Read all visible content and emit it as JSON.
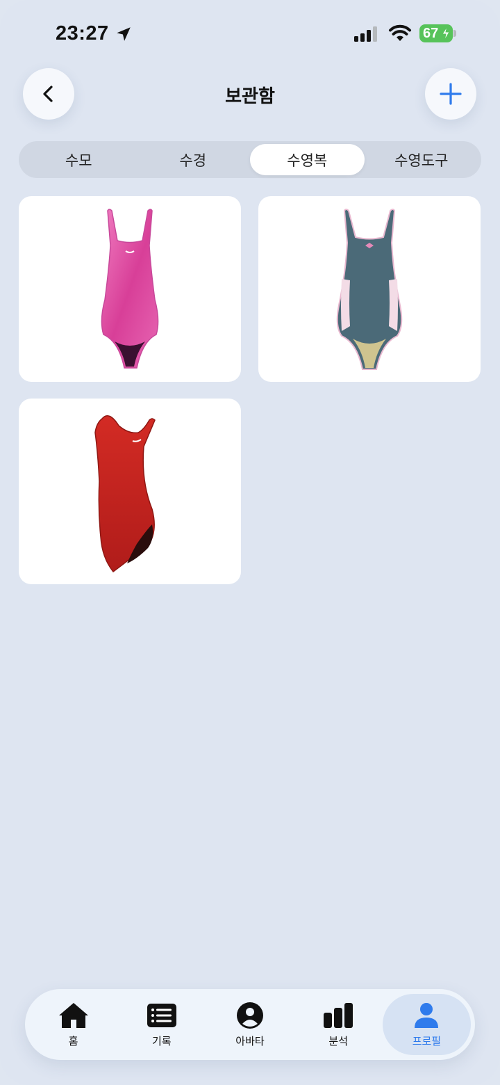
{
  "status_bar": {
    "time": "23:27",
    "battery": "67"
  },
  "header": {
    "title": "보관함"
  },
  "segments": [
    {
      "label": "수모",
      "active": false
    },
    {
      "label": "수경",
      "active": false
    },
    {
      "label": "수영복",
      "active": true
    },
    {
      "label": "수영도구",
      "active": false
    }
  ],
  "items": [
    {
      "name": "pink-swimsuit",
      "color": "#e04f9e"
    },
    {
      "name": "blue-swimsuit",
      "color": "#4b6a78"
    },
    {
      "name": "red-swimsuit",
      "color": "#c4241f"
    }
  ],
  "tabbar": [
    {
      "label": "홈",
      "icon": "home-icon",
      "active": false
    },
    {
      "label": "기록",
      "icon": "list-icon",
      "active": false
    },
    {
      "label": "아바타",
      "icon": "avatar-icon",
      "active": false
    },
    {
      "label": "분석",
      "icon": "bar-chart-icon",
      "active": false
    },
    {
      "label": "프로필",
      "icon": "profile-icon",
      "active": true
    }
  ],
  "colors": {
    "accent": "#2f7bec",
    "background": "#dee5f1",
    "battery": "#57c35a"
  }
}
